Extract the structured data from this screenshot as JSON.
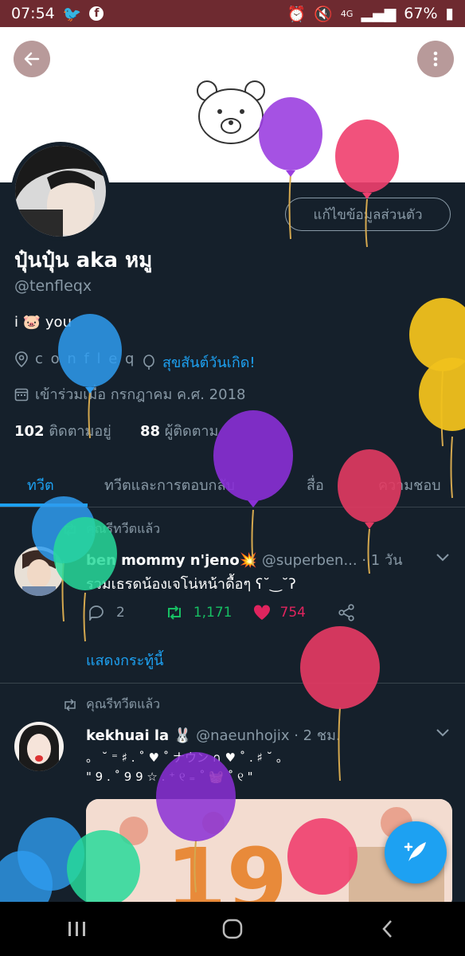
{
  "status": {
    "time": "07:54",
    "signal_label": "4G",
    "battery": "67%"
  },
  "profile": {
    "name": "ปุ๋นปุ๋น aka หมู",
    "handle": "@tenfleqx",
    "bio_before": "i",
    "bio_emoji": "🐷",
    "bio_after": "you",
    "location": "c o n f l e q",
    "birthday": "สุขสันต์วันเกิด!",
    "joined": "เข้าร่วมเมื่อ กรกฎาคม ค.ศ. 2018",
    "following_count": "102",
    "following_label": "ติดตามอยู่",
    "followers_count": "88",
    "followers_label": "ผู้ติดตาม",
    "edit_label": "แก้ไขข้อมูลส่วนตัว"
  },
  "tabs": [
    {
      "label": "ทวีต"
    },
    {
      "label": "ทวีตและการตอบกลับ"
    },
    {
      "label": "สื่อ"
    },
    {
      "label": "ความชอบ"
    }
  ],
  "tweets": [
    {
      "retweet_label": "คุณรีทวีตแล้ว",
      "author": "ben mommy n'jeno",
      "author_emoji": "💥",
      "handle": "@superben...",
      "time": "· 1 วัน",
      "text": "รวมเธรดน้องเจโน่หน้าดื้อๆ ʕ˘‿˘ʔ",
      "replies": "2",
      "retweets": "1,171",
      "likes": "754",
      "show_thread": "แสดงกระทู้นี้"
    },
    {
      "retweet_label": "คุณรีทวีตแล้ว",
      "author": "kekhuai la",
      "author_emoji": "🐰",
      "handle": "@naeunhojix",
      "time": "· 2 ชม.",
      "text_line1": "。 ˘ ⁼ ♯ . ˚ ♥ ˚ ナウン ∩ ♥ ˚ . ♯ ˘ 。",
      "text_line2": "\" 9 . ˚ 9 9 ☆ . ⁺ ୧ ₌ ˚ 🧺 ˚ ୧ \""
    }
  ],
  "colors": {
    "accent": "#1da1f2",
    "background": "#15202b",
    "retweet": "#17bf63",
    "like": "#e0245e"
  }
}
